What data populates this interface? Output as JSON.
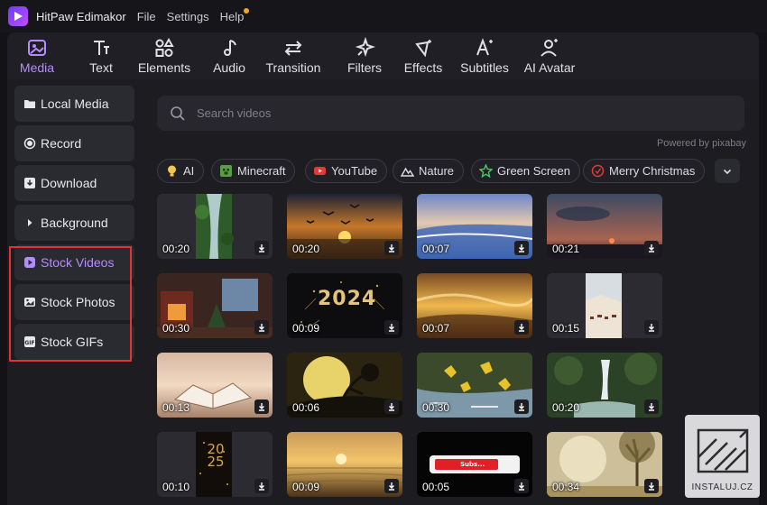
{
  "app": {
    "title": "HitPaw Edimakor"
  },
  "menu": {
    "file": "File",
    "settings": "Settings",
    "help": "Help"
  },
  "toolbar": {
    "tabs": [
      {
        "label": "Media",
        "icon": "media-icon",
        "active": true
      },
      {
        "label": "Text",
        "icon": "text-icon"
      },
      {
        "label": "Elements",
        "icon": "elements-icon"
      },
      {
        "label": "Audio",
        "icon": "audio-icon"
      },
      {
        "label": "Transition",
        "icon": "transition-icon"
      },
      {
        "label": "Filters",
        "icon": "filters-icon"
      },
      {
        "label": "Effects",
        "icon": "effects-icon"
      },
      {
        "label": "Subtitles",
        "icon": "subtitles-icon"
      },
      {
        "label": "AI Avatar",
        "icon": "ai-avatar-icon"
      }
    ]
  },
  "sidebar": {
    "items": [
      {
        "label": "Local Media",
        "icon": "folder-icon"
      },
      {
        "label": "Record",
        "icon": "record-icon"
      },
      {
        "label": "Download",
        "icon": "download-icon"
      },
      {
        "label": "Background",
        "icon": "caret-right-icon"
      },
      {
        "label": "Stock Videos",
        "icon": "video-icon",
        "active": true
      },
      {
        "label": "Stock Photos",
        "icon": "photo-icon"
      },
      {
        "label": "Stock GIFs",
        "icon": "gif-icon"
      }
    ]
  },
  "search": {
    "placeholder": "Search videos"
  },
  "powered_by": "Powered by pixabay",
  "categories": [
    {
      "label": "AI",
      "icon": "ai-bulb-icon"
    },
    {
      "label": "Minecraft",
      "icon": "minecraft-icon"
    },
    {
      "label": "YouTube",
      "icon": "youtube-icon"
    },
    {
      "label": "Nature",
      "icon": "mountain-icon"
    },
    {
      "label": "Green Screen",
      "icon": "green-screen-icon"
    },
    {
      "label": "Merry Christmas",
      "icon": "christmas-icon"
    }
  ],
  "videos": [
    {
      "duration": "00:20",
      "scene": "forest waterfall"
    },
    {
      "duration": "00:20",
      "scene": "sunset birds"
    },
    {
      "duration": "00:07",
      "scene": "beach waves"
    },
    {
      "duration": "00:21",
      "scene": "sunset clouds"
    },
    {
      "duration": "00:30",
      "scene": "christmas fireplace"
    },
    {
      "duration": "00:09",
      "scene": "2024 fireworks",
      "text": "2024"
    },
    {
      "duration": "00:07",
      "scene": "golden clouds"
    },
    {
      "duration": "00:15",
      "scene": "desert horses"
    },
    {
      "duration": "00:13",
      "scene": "book beach"
    },
    {
      "duration": "00:06",
      "scene": "full moon tree"
    },
    {
      "duration": "00:30",
      "scene": "autumn leaves stream"
    },
    {
      "duration": "00:20",
      "scene": "waterfall forest"
    },
    {
      "duration": "00:10",
      "scene": "2025 sparkle",
      "text": "2025"
    },
    {
      "duration": "00:09",
      "scene": "ocean sunset"
    },
    {
      "duration": "00:05",
      "scene": "subscribe button",
      "text": "Subs..."
    },
    {
      "duration": "00:34",
      "scene": "foggy forest"
    }
  ],
  "watermark": {
    "text": "INSTALUJ.CZ"
  },
  "colors": {
    "accent": "#b58cff",
    "highlight": "#e33333",
    "help_dot": "#f5a623"
  }
}
